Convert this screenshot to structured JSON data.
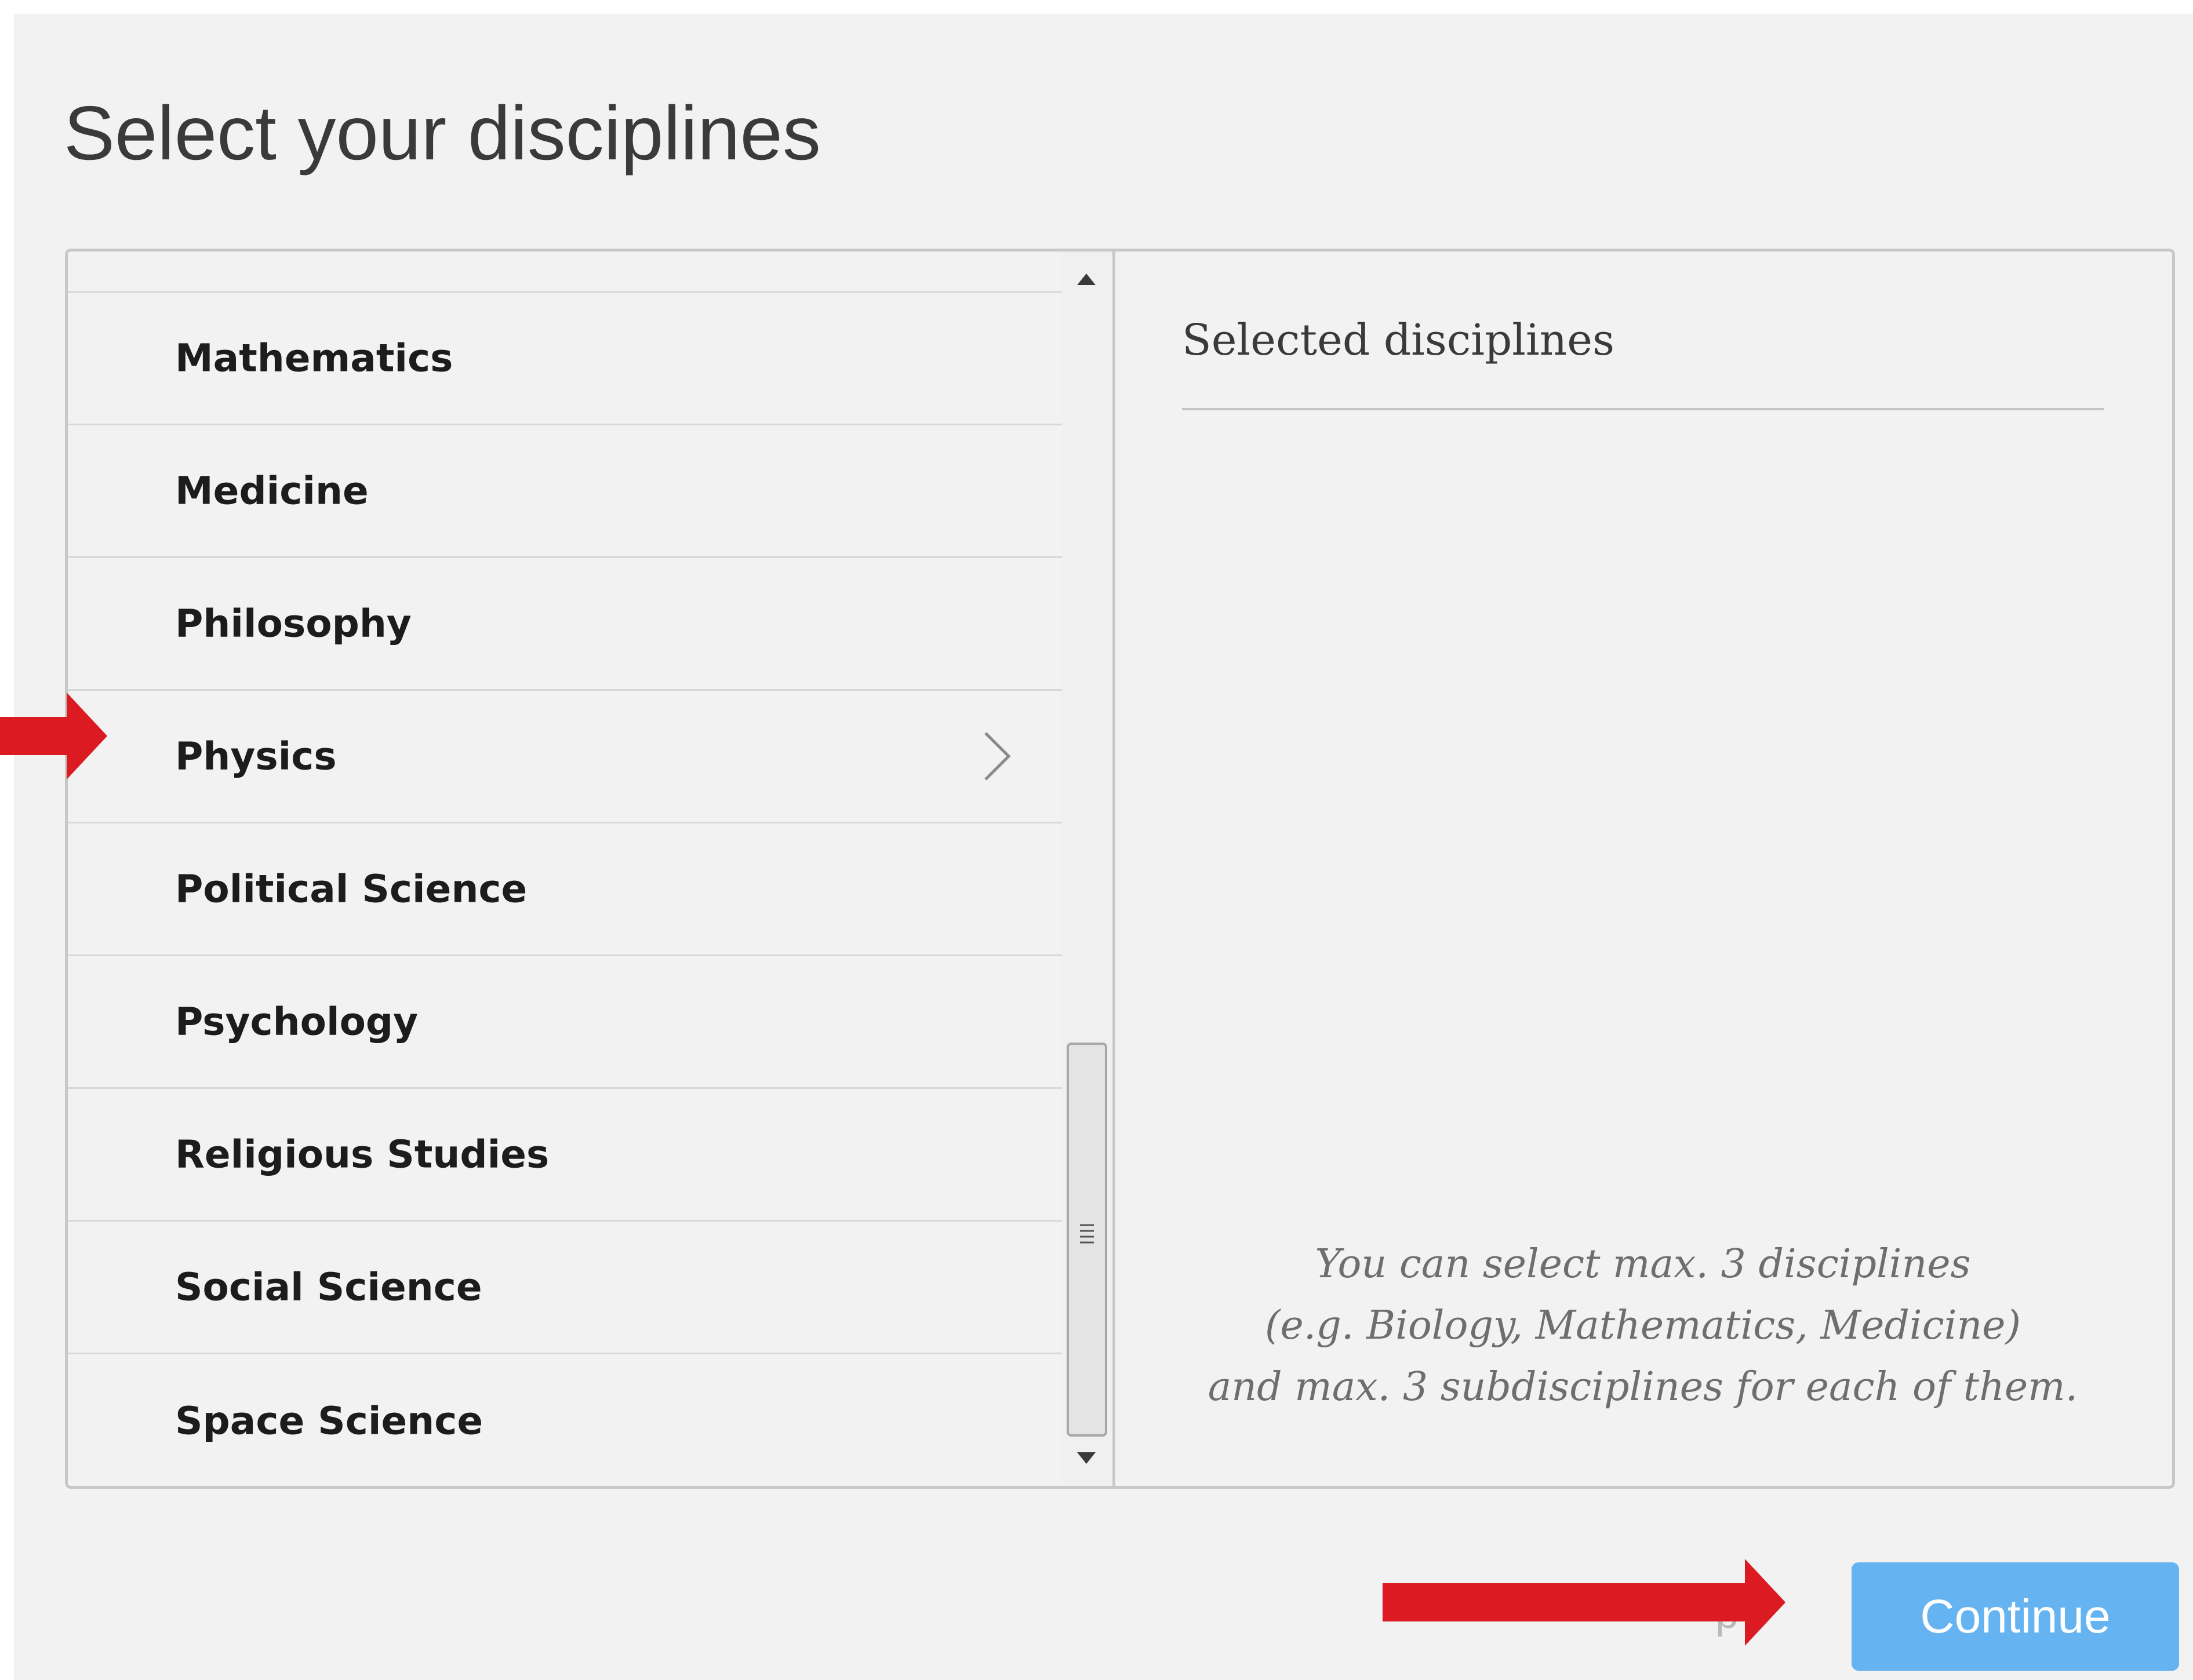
{
  "page": {
    "title": "Select your disciplines"
  },
  "disciplines": {
    "items": [
      {
        "label": "Mathematics"
      },
      {
        "label": "Medicine"
      },
      {
        "label": "Philosophy"
      },
      {
        "label": "Physics",
        "has_chevron": true
      },
      {
        "label": "Political Science"
      },
      {
        "label": "Psychology"
      },
      {
        "label": "Religious Studies"
      },
      {
        "label": "Social Science"
      },
      {
        "label": "Space Science"
      }
    ]
  },
  "selected": {
    "title": "Selected disciplines",
    "hint_lines": [
      "You can select max. 3 disciplines",
      "(e.g. Biology, Mathematics, Medicine)",
      "and max. 3 subdisciplines for each of them."
    ]
  },
  "footer": {
    "skip_label": "p",
    "continue_label": "Continue"
  },
  "annotations": {
    "arrow_color": "#dc1a22"
  },
  "icons": {
    "chevron": "chevron-right-icon",
    "scroll_up": "scroll-up-arrow-icon",
    "scroll_down": "scroll-down-arrow-icon",
    "grip": "grip-lines-icon"
  }
}
